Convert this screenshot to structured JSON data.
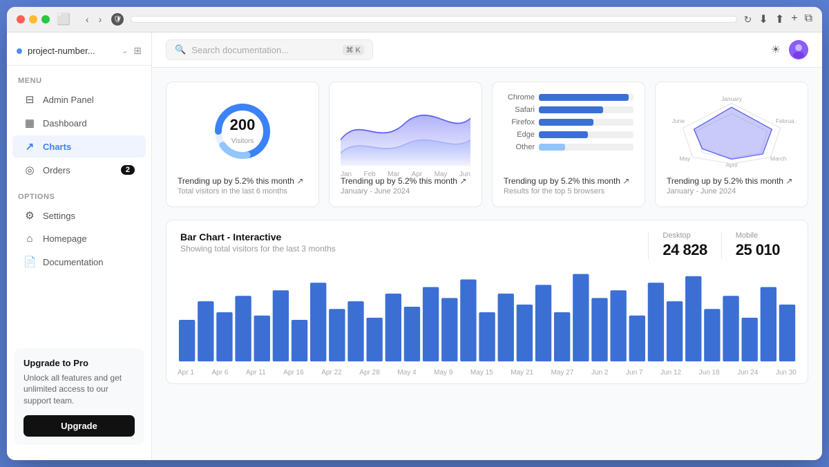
{
  "browser": {
    "address": ""
  },
  "sidebar": {
    "project": "project-number...",
    "menu_label": "MENU",
    "items": [
      {
        "id": "admin-panel",
        "label": "Admin Panel",
        "icon": "⊞",
        "active": false
      },
      {
        "id": "dashboard",
        "label": "Dashboard",
        "icon": "▦",
        "active": false
      },
      {
        "id": "charts",
        "label": "Charts",
        "icon": "📈",
        "active": true
      },
      {
        "id": "orders",
        "label": "Orders",
        "icon": "⊙",
        "active": false,
        "badge": "2"
      }
    ],
    "options_label": "OPTIONS",
    "options": [
      {
        "id": "settings",
        "label": "Settings",
        "icon": "⚙"
      },
      {
        "id": "homepage",
        "label": "Homepage",
        "icon": "⌂"
      },
      {
        "id": "documentation",
        "label": "Documentation",
        "icon": "📄"
      }
    ],
    "upgrade_title": "Upgrade to Pro",
    "upgrade_desc": "Unlock all features and get unlimited access to our support team.",
    "upgrade_btn": "Upgrade"
  },
  "topbar": {
    "search_placeholder": "Search documentation...",
    "search_shortcut": "⌘ K"
  },
  "stats": [
    {
      "type": "donut",
      "value": "200",
      "value_label": "Visitors",
      "trend": "Trending up by 5.2% this month",
      "sub": "Total visitors in the last 6 months",
      "donut_progress": 0.72
    },
    {
      "type": "area",
      "trend": "Trending up by 5.2% this month",
      "sub": "January - June 2024",
      "x_labels": [
        "Jan",
        "Feb",
        "Mar",
        "Apr",
        "May",
        "Jun"
      ]
    },
    {
      "type": "hbar",
      "trend": "Trending up by 5.2% this month",
      "sub": "Results for the top 5 browsers",
      "bars": [
        {
          "label": "Chrome",
          "pct": 95
        },
        {
          "label": "Safari",
          "pct": 68
        },
        {
          "label": "Firefox",
          "pct": 58
        },
        {
          "label": "Edge",
          "pct": 52
        },
        {
          "label": "Other",
          "pct": 28
        }
      ]
    },
    {
      "type": "radar",
      "trend": "Trending up by 5.2% this month",
      "sub": "January - June 2024",
      "radar_labels": [
        "January",
        "February",
        "March",
        "April",
        "May",
        "June"
      ]
    }
  ],
  "bar_chart": {
    "title": "Bar Chart - Interactive",
    "sub": "Showing total visitors for the last 3 months",
    "desktop_label": "Desktop",
    "desktop_value": "24 828",
    "mobile_label": "Mobile",
    "mobile_value": "25 010",
    "x_labels": [
      "Apr 1",
      "Apr 6",
      "Apr 11",
      "Apr 16",
      "Apr 22",
      "Apr 28",
      "May 4",
      "May 9",
      "May 15",
      "May 21",
      "May 27",
      "Jun 2",
      "Jun 7",
      "Jun 12",
      "Jun 18",
      "Jun 24",
      "Jun 30"
    ],
    "bars": [
      38,
      55,
      45,
      60,
      42,
      65,
      38,
      72,
      48,
      55,
      40,
      62,
      50,
      68,
      58,
      75,
      45,
      62,
      52,
      70,
      45,
      80,
      58,
      65,
      42,
      72,
      55,
      78,
      48,
      60,
      40,
      68,
      52
    ]
  }
}
